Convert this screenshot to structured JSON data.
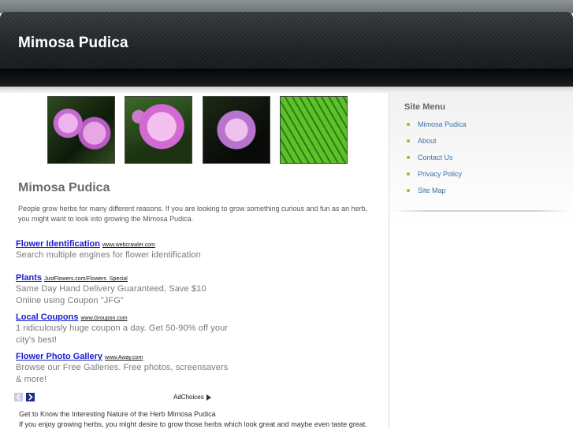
{
  "site": {
    "title": "Mimosa Pudica"
  },
  "gallery": {
    "icons": [
      "mimosa-flower-photo-1",
      "mimosa-flower-photo-2",
      "mimosa-flower-photo-3",
      "mimosa-leaves-photo"
    ]
  },
  "main": {
    "title": "Mimosa Pudica",
    "intro_line1": "People grow herbs for many different reasons. If you are looking to grow something curious and fun as an herb,",
    "intro_line2": "you might want to look into growing the Mimosa Pudica."
  },
  "ads": [
    {
      "title": "Flower Identification",
      "url": "www.webcrawler.com",
      "desc": "Search multiple engines for flower identification"
    },
    {
      "title": "Plants",
      "url": "JustFlowers.com/Flowers_Special",
      "desc": "Same Day Hand Delivery Guaranteed, Save $10 Online using Coupon \"JFG\""
    },
    {
      "title": "Local Coupons",
      "url": "www.Groupon.com",
      "desc": "1 ridiculously huge coupon a day. Get 50-90% off your city's best!"
    },
    {
      "title": "Flower Photo Gallery",
      "url": "www.Away.com",
      "desc": "Browse our Free Galleries. Free photos, screensavers & more!"
    }
  ],
  "ad_controls": {
    "adchoices_label": "AdChoices"
  },
  "article": {
    "title": "Get to Know the Interesting Nature of the Herb Mimosa Pudica",
    "text": "If you enjoy growing herbs, you might desire to grow those herbs which look great and maybe even taste great."
  },
  "sidebar": {
    "title": "Site Menu",
    "items": [
      {
        "label": "Mimosa Pudica"
      },
      {
        "label": "About"
      },
      {
        "label": "Contact Us"
      },
      {
        "label": "Privacy Policy"
      },
      {
        "label": "Site Map"
      }
    ]
  },
  "colors": {
    "link": "#1a1acf",
    "menu_link": "#3a6fa8",
    "bullet": "#8fbf3a",
    "header_dark": "#1f2224"
  }
}
